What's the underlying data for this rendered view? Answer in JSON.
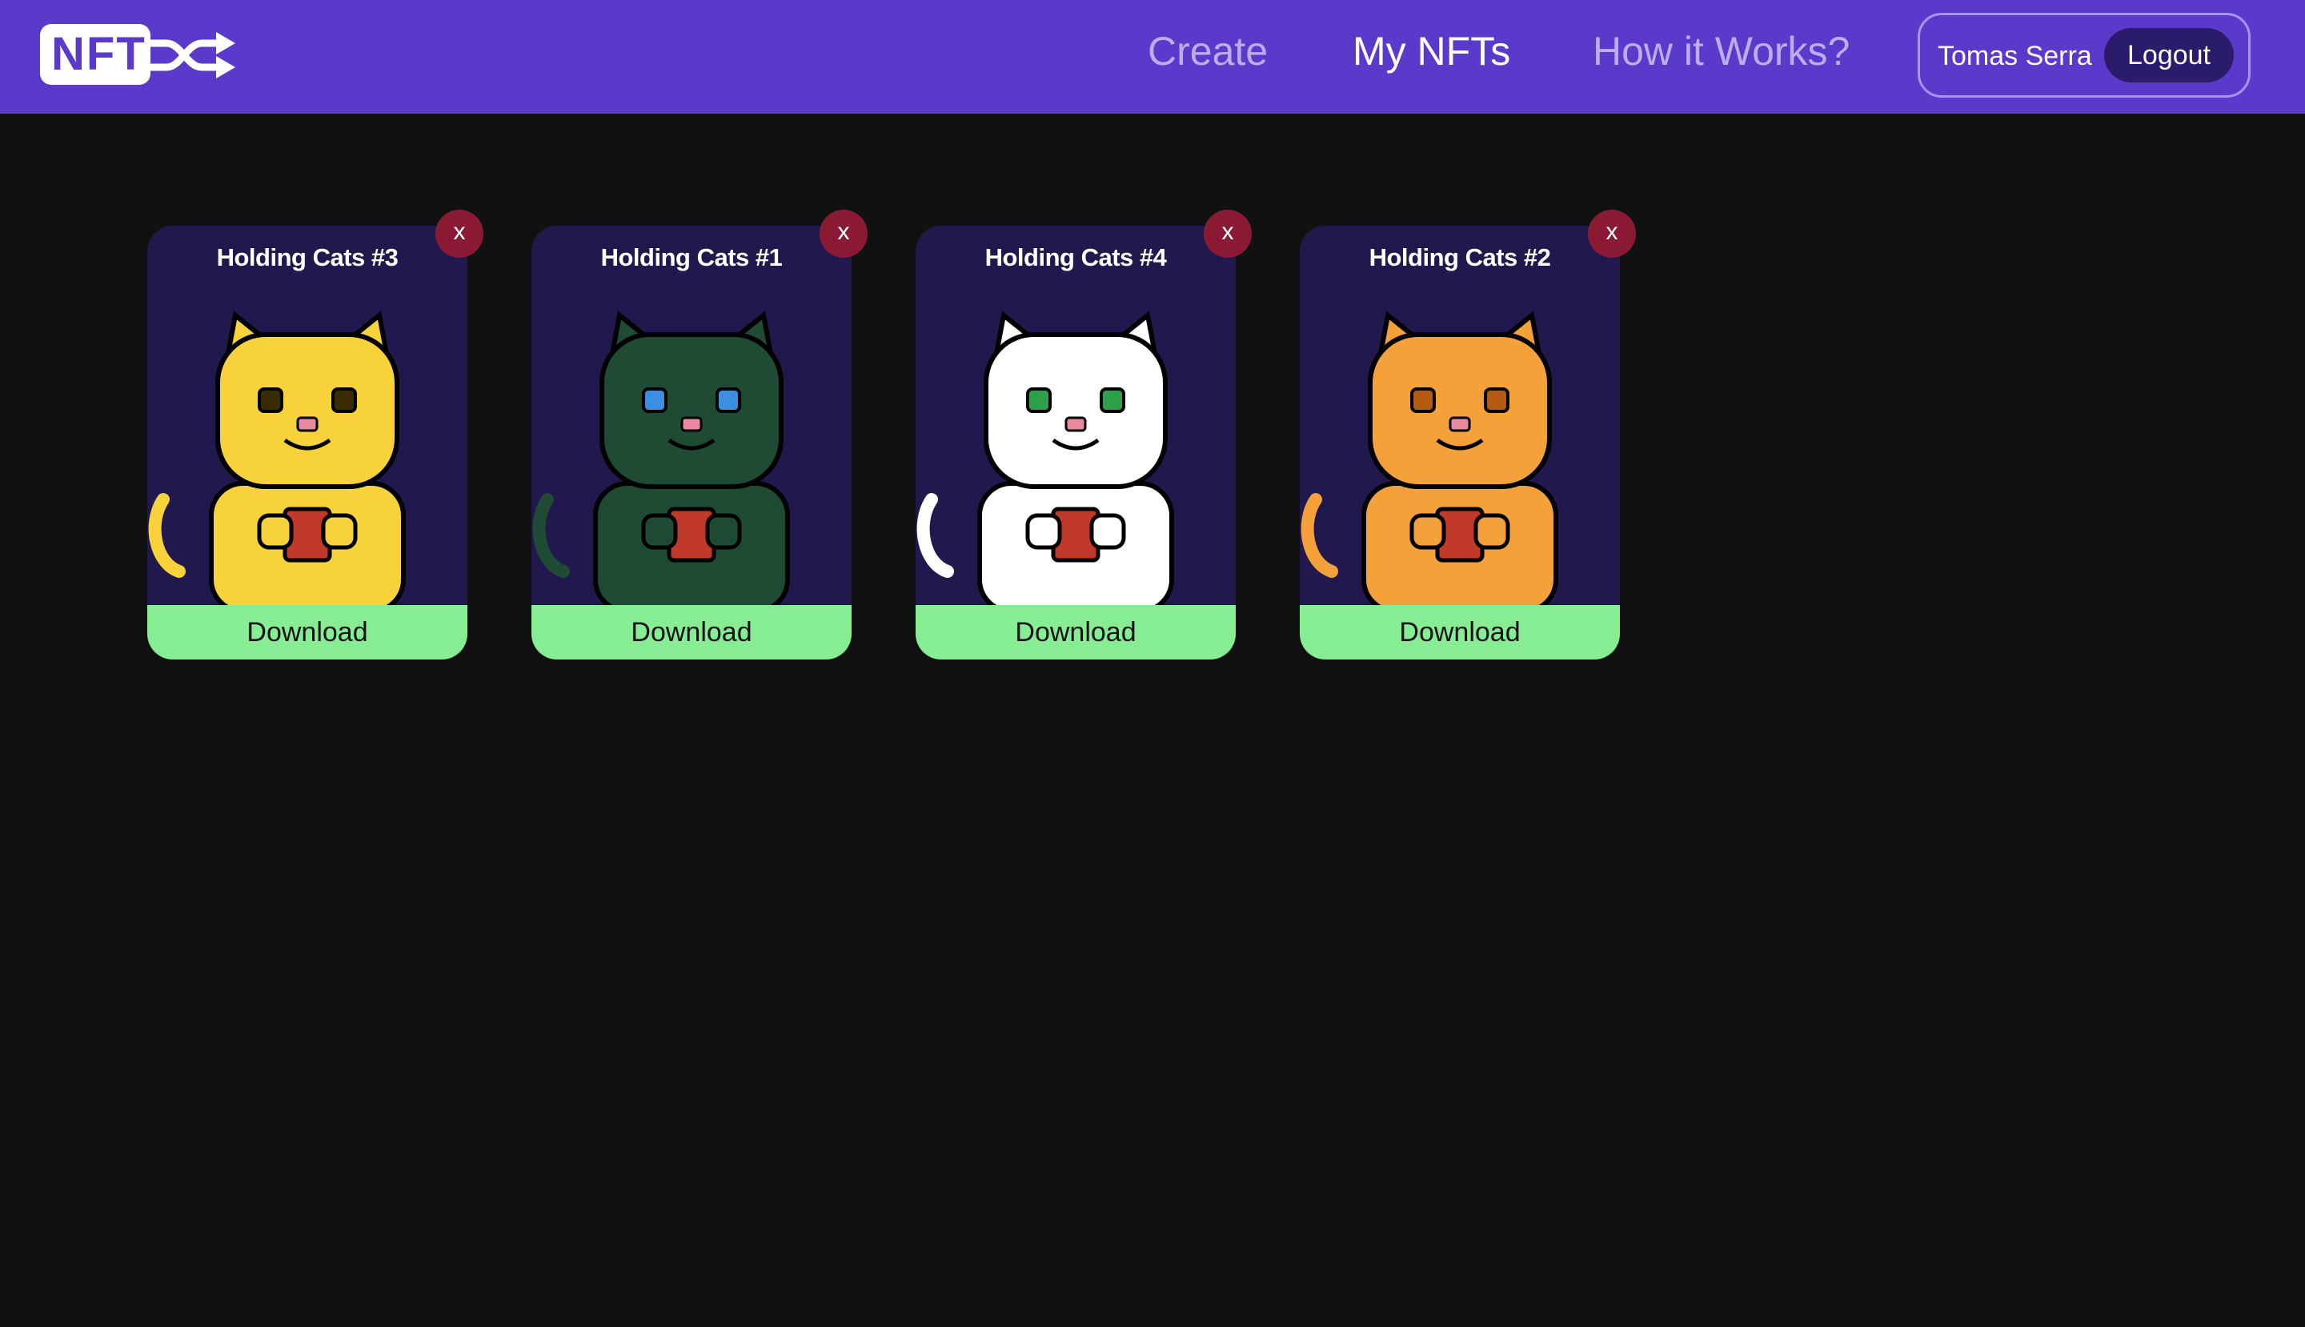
{
  "header": {
    "logo_text": "NFT",
    "logo_icon": "shuffle-icon",
    "nav": [
      {
        "label": "Create",
        "active": false
      },
      {
        "label": "My NFTs",
        "active": true
      },
      {
        "label": "How it Works?",
        "active": false
      }
    ],
    "user": {
      "name": "Tomas Serra",
      "logout_label": "Logout"
    }
  },
  "cards": [
    {
      "title": "Holding Cats #3",
      "download_label": "Download",
      "remove_label": "x",
      "cat_color": "#f8d23a",
      "eye_color": "#3a2a00"
    },
    {
      "title": "Holding Cats #1",
      "download_label": "Download",
      "remove_label": "x",
      "cat_color": "#1f4a33",
      "eye_color": "#3a8fe0"
    },
    {
      "title": "Holding Cats #4",
      "download_label": "Download",
      "remove_label": "x",
      "cat_color": "#ffffff",
      "eye_color": "#2fa04a"
    },
    {
      "title": "Holding Cats #2",
      "download_label": "Download",
      "remove_label": "x",
      "cat_color": "#f5a13a",
      "eye_color": "#b55a12"
    }
  ],
  "colors": {
    "header_bg": "#5a3acb",
    "page_bg": "#111111",
    "card_bg": "#21194e",
    "download_bg": "#86ed94",
    "remove_bg": "#8a1a33"
  }
}
